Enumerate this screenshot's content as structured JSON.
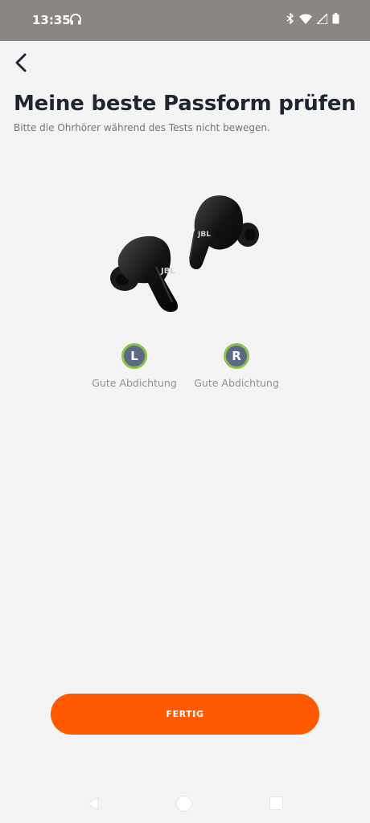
{
  "status_bar": {
    "time": "13:35",
    "icons": [
      "headphone-icon",
      "bluetooth-icon",
      "wifi-icon",
      "signal-icon",
      "battery-icon"
    ],
    "background_color": "#8b8682"
  },
  "header": {
    "back_icon": "chevron-left-icon",
    "title": "Meine beste Passform prüfen",
    "subtitle": "Bitte die Ohrhörer während des Tests nicht bewegen."
  },
  "fit_results": [
    {
      "side": "L",
      "status": "Gute Abdichtung",
      "ring_color": "#8bc34a"
    },
    {
      "side": "R",
      "status": "Gute Abdichtung",
      "ring_color": "#8bc34a"
    }
  ],
  "action": {
    "done_label": "FERTIG",
    "color": "#ff5a00"
  },
  "nav_bar": {
    "icons": [
      "nav-back-icon",
      "nav-home-icon",
      "nav-recents-icon"
    ]
  }
}
